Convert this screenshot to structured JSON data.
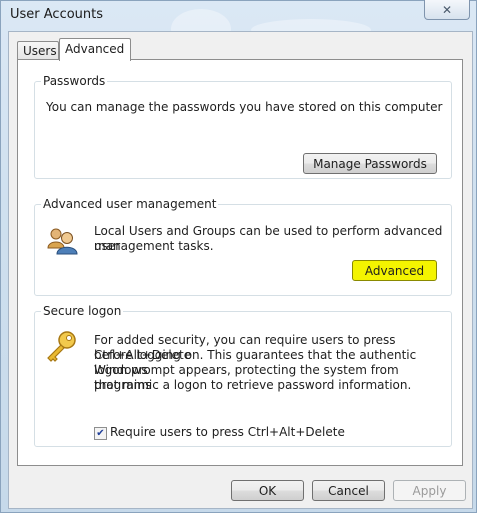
{
  "window": {
    "title": "User Accounts",
    "close_glyph": "✕"
  },
  "tabs": [
    {
      "label": "Users"
    },
    {
      "label": "Advanced",
      "active": true
    }
  ],
  "passwords": {
    "title": "Passwords",
    "description": "You can manage the passwords you have stored on this computer",
    "button": "Manage Passwords"
  },
  "advanced_management": {
    "title": "Advanced user management",
    "description_line1": "Local Users and Groups can be used to perform advanced user",
    "description_line2": "management tasks.",
    "button": "Advanced",
    "icon": "users-group-icon",
    "highlight_color": "#f4f400"
  },
  "secure_logon": {
    "title": "Secure logon",
    "description_lines": [
      "For added security, you can require users to press Ctrl+Alt+Delete",
      "before logging on. This guarantees that the authentic Windows",
      "logon prompt appears, protecting the system from programs",
      "that mimic a logon to retrieve password information."
    ],
    "icon": "key-icon",
    "checkbox_label": "Require users to press Ctrl+Alt+Delete",
    "checkbox_checked": true
  },
  "footer": {
    "ok": "OK",
    "cancel": "Cancel",
    "apply": "Apply"
  }
}
